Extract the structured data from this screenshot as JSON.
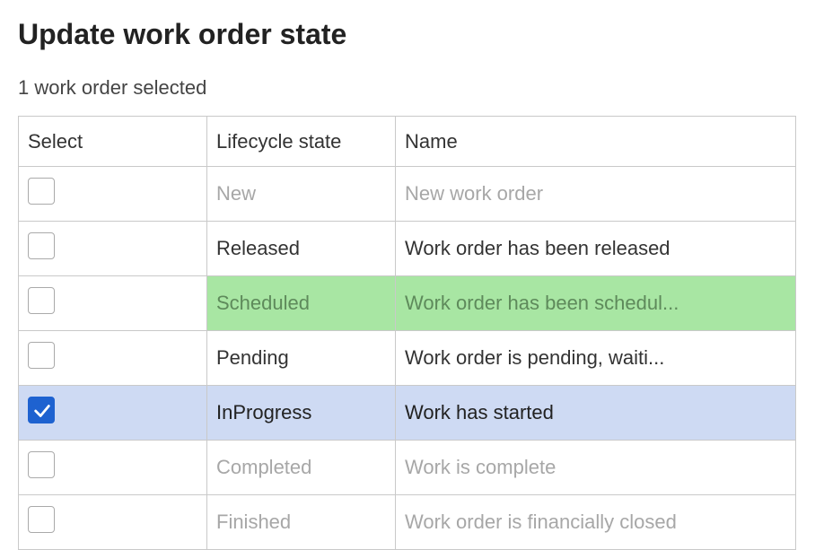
{
  "header": {
    "title": "Update work order state",
    "subtext": "1 work order selected"
  },
  "table": {
    "columns": {
      "select": "Select",
      "lifecycle": "Lifecycle state",
      "name": "Name"
    },
    "rows": [
      {
        "id": "new",
        "state": "New",
        "name": "New work order",
        "checked": false,
        "enabled": false,
        "highlight": null,
        "selected": false
      },
      {
        "id": "released",
        "state": "Released",
        "name": "Work order has been released",
        "checked": false,
        "enabled": true,
        "highlight": null,
        "selected": false
      },
      {
        "id": "scheduled",
        "state": "Scheduled",
        "name": "Work order has been schedul...",
        "checked": false,
        "enabled": true,
        "highlight": "green",
        "selected": false
      },
      {
        "id": "pending",
        "state": "Pending",
        "name": "Work order is pending,  waiti...",
        "checked": false,
        "enabled": true,
        "highlight": null,
        "selected": false
      },
      {
        "id": "inprogress",
        "state": "InProgress",
        "name": "Work has started",
        "checked": true,
        "enabled": true,
        "highlight": null,
        "selected": true
      },
      {
        "id": "completed",
        "state": "Completed",
        "name": "Work is complete",
        "checked": false,
        "enabled": false,
        "highlight": null,
        "selected": false
      },
      {
        "id": "finished",
        "state": "Finished",
        "name": "Work order is financially closed",
        "checked": false,
        "enabled": false,
        "highlight": null,
        "selected": false
      }
    ]
  }
}
